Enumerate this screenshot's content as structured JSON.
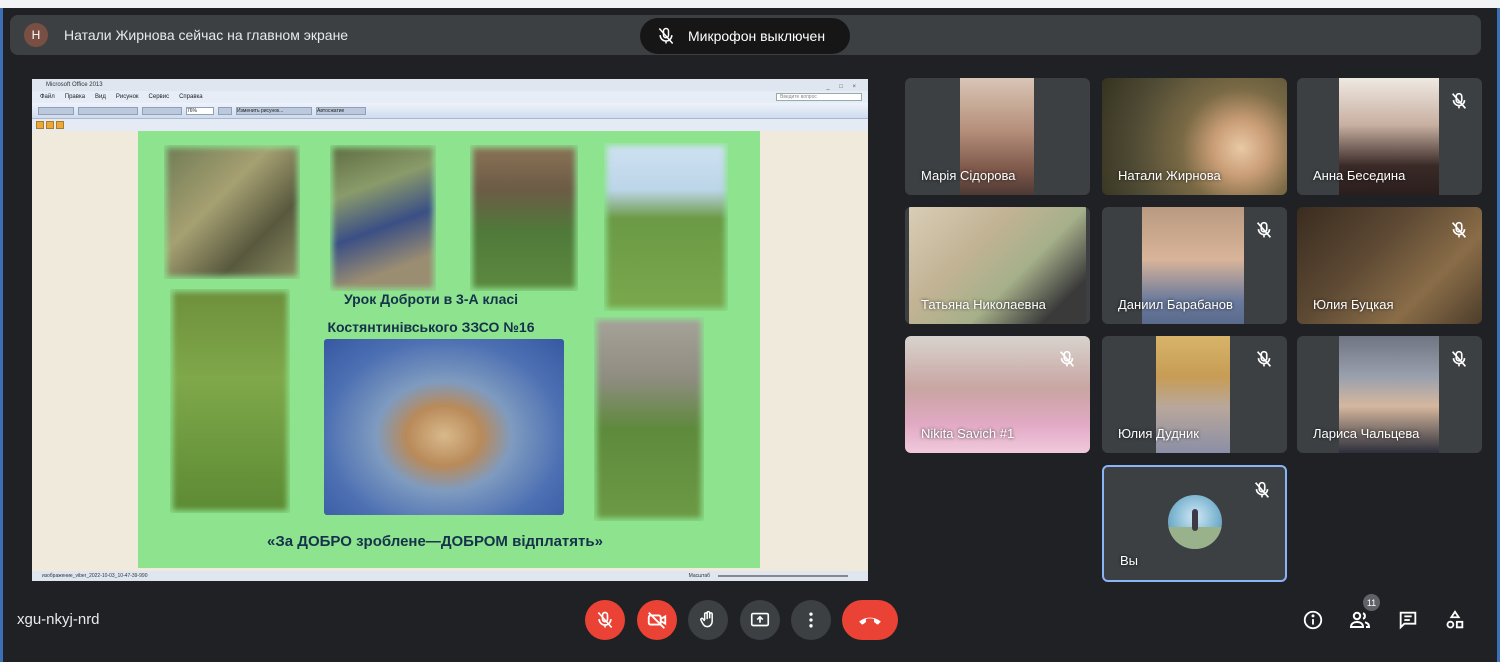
{
  "banner": {
    "avatar_letter": "Н",
    "text": "Натали Жирнова сейчас на главном экране"
  },
  "mic_toast": {
    "text": "Микрофон выключен"
  },
  "presentation": {
    "window_title": "Microsoft Office 2013",
    "menu": [
      "Файл",
      "Правка",
      "Вид",
      "Рисунок",
      "Сервис",
      "Справка"
    ],
    "search_placeholder": "Введите вопрос",
    "zoom": "76%",
    "toolbar_buttons": [
      "Изменить рисунок...",
      "Автосжатие"
    ],
    "status_left": "изображение_viber_2022-10-03_10-47-39-990",
    "status_zoom": "Масштаб",
    "slide": {
      "line1": "Урок Доброти в 3-А класі",
      "line2": "Костянтинівського ЗЗСО №16",
      "caption": "«За ДОБРО зроблене—ДОБРОМ відплатять»"
    }
  },
  "participants": [
    {
      "name": "Марія Сідорова",
      "muted": false
    },
    {
      "name": "Натали Жирнова",
      "muted": false
    },
    {
      "name": "Анна Беседина",
      "muted": true
    },
    {
      "name": "Татьяна Николаевна",
      "muted": false
    },
    {
      "name": "Даниил Барабанов",
      "muted": true
    },
    {
      "name": "Юлия Буцкая",
      "muted": true
    },
    {
      "name": "Nikita Savich #1",
      "muted": true
    },
    {
      "name": "Юлия Дудник",
      "muted": true
    },
    {
      "name": "Лариса Чальцева",
      "muted": true
    },
    {
      "name": "Вы",
      "muted": true
    }
  ],
  "bottom_bar": {
    "meeting_code": "xgu-nkyj-nrd",
    "participant_count": "11",
    "icons": [
      "mic-off-icon",
      "camera-off-icon",
      "raise-hand-icon",
      "present-icon",
      "more-icon",
      "end-call-icon",
      "info-icon",
      "people-icon",
      "chat-icon",
      "activities-icon"
    ],
    "colors": {
      "danger": "#ea4335",
      "surface": "#3c4043",
      "background": "#202124",
      "accent": "#8ab4f8"
    }
  }
}
